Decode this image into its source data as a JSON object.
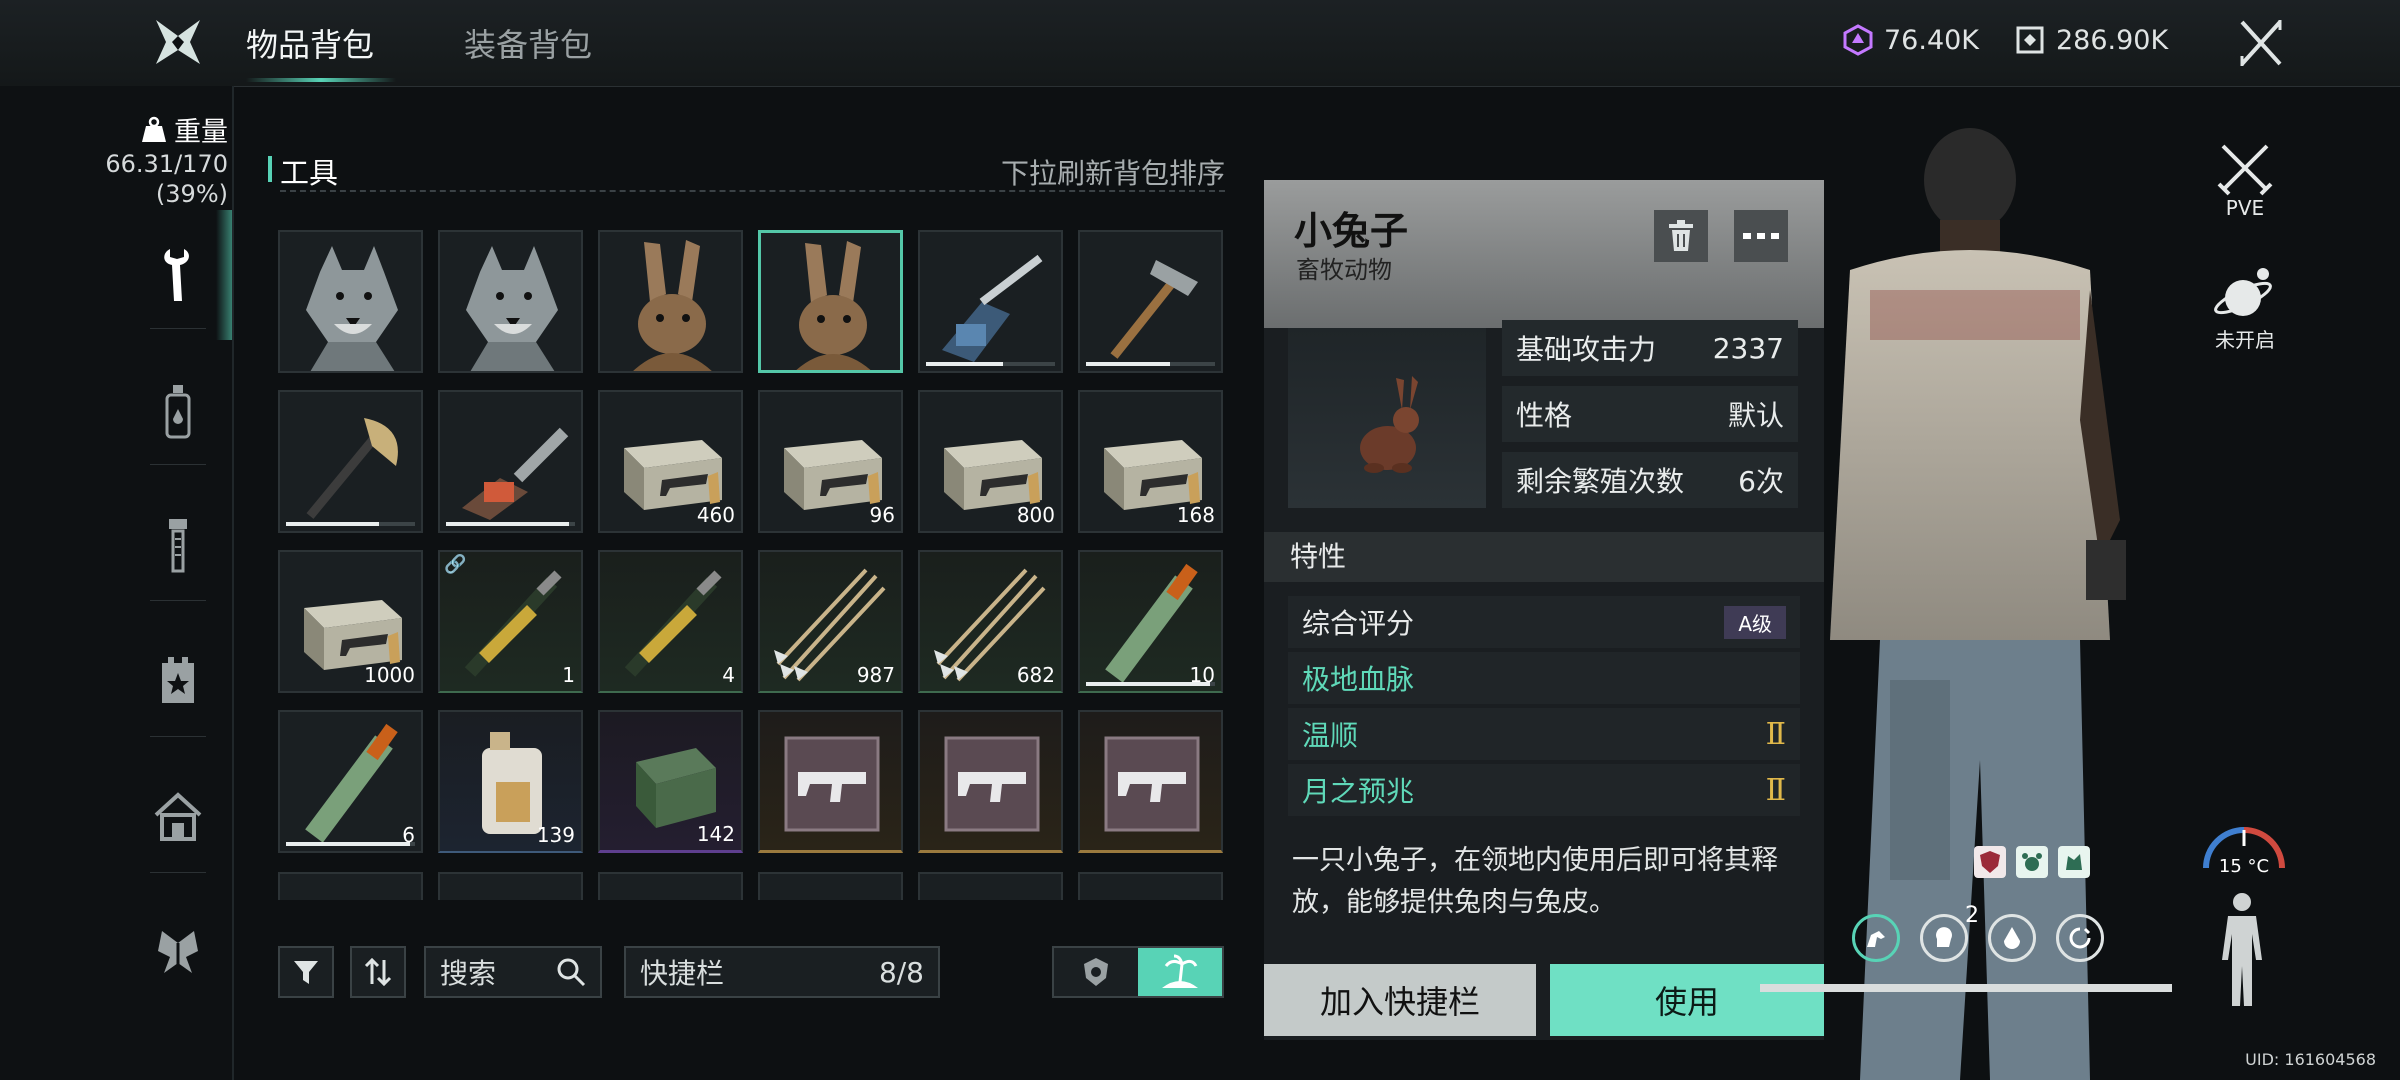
{
  "header": {
    "tabs": [
      {
        "label": "物品背包",
        "active": true
      },
      {
        "label": "装备背包",
        "active": false
      }
    ],
    "currency_a": "76.40K",
    "currency_b": "286.90K"
  },
  "weight": {
    "label": "重量",
    "value": "66.31/170",
    "percent": "(39%)"
  },
  "inventory": {
    "category": "工具",
    "refresh_hint": "下拉刷新背包排序",
    "items": [
      {
        "name": "wolf",
        "count": ""
      },
      {
        "name": "wolf",
        "count": ""
      },
      {
        "name": "rabbit",
        "count": ""
      },
      {
        "name": "rabbit",
        "count": "",
        "selected": true
      },
      {
        "name": "welder",
        "count": "",
        "durability": 0.6
      },
      {
        "name": "hammer",
        "count": "",
        "durability": 0.65
      },
      {
        "name": "axe",
        "count": "",
        "durability": 0.72
      },
      {
        "name": "chainsaw",
        "count": "",
        "durability": 0.95
      },
      {
        "name": "ammo-crate",
        "count": "460"
      },
      {
        "name": "ammo-crate",
        "count": "96"
      },
      {
        "name": "ammo-crate",
        "count": "800"
      },
      {
        "name": "ammo-crate",
        "count": "168"
      },
      {
        "name": "ammo-crate",
        "count": "1000"
      },
      {
        "name": "rockets",
        "count": "1"
      },
      {
        "name": "rockets",
        "count": "4"
      },
      {
        "name": "arrows",
        "count": "987"
      },
      {
        "name": "arrows",
        "count": "682"
      },
      {
        "name": "flare",
        "count": "10",
        "durability": 0.96
      },
      {
        "name": "flare",
        "count": "6",
        "durability": 0.96
      },
      {
        "name": "fuel-jug",
        "count": "139"
      },
      {
        "name": "battery",
        "count": "142"
      },
      {
        "name": "smg-blueprint",
        "count": ""
      },
      {
        "name": "smg-blueprint",
        "count": ""
      },
      {
        "name": "smg-blueprint",
        "count": ""
      }
    ]
  },
  "controls": {
    "search": "搜索",
    "quickbar_label": "快捷栏",
    "quickbar_count": "8/8"
  },
  "detail": {
    "name": "小兔子",
    "type": "畜牧动物",
    "stats": [
      {
        "label": "基础攻击力",
        "value": "2337"
      },
      {
        "label": "性格",
        "value": "默认"
      },
      {
        "label": "剩余繁殖次数",
        "value": "6次"
      }
    ],
    "traits_title": "特性",
    "overall_label": "综合评分",
    "overall_grade": "A级",
    "traits": [
      {
        "label": "极地血脉",
        "level": ""
      },
      {
        "label": "温顺",
        "level": "Ⅱ"
      },
      {
        "label": "月之预兆",
        "level": "Ⅱ"
      }
    ],
    "description": "一只小兔子，在领地内使用后即可将其释放，能够提供兔肉与兔皮。",
    "add_quick_label": "加入快捷栏",
    "use_label": "使用"
  },
  "right_panel": {
    "pve_label": "PVE",
    "planet_label": "未开启",
    "temperature": "15 °C",
    "buff_count": "2"
  },
  "uid": "UID: 161604568",
  "colors": {
    "accent": "#58d3b6",
    "use_button": "#6fe0c4",
    "gold_rarity": "#9b7a3e",
    "purple_rarity": "#5e3f8f"
  }
}
